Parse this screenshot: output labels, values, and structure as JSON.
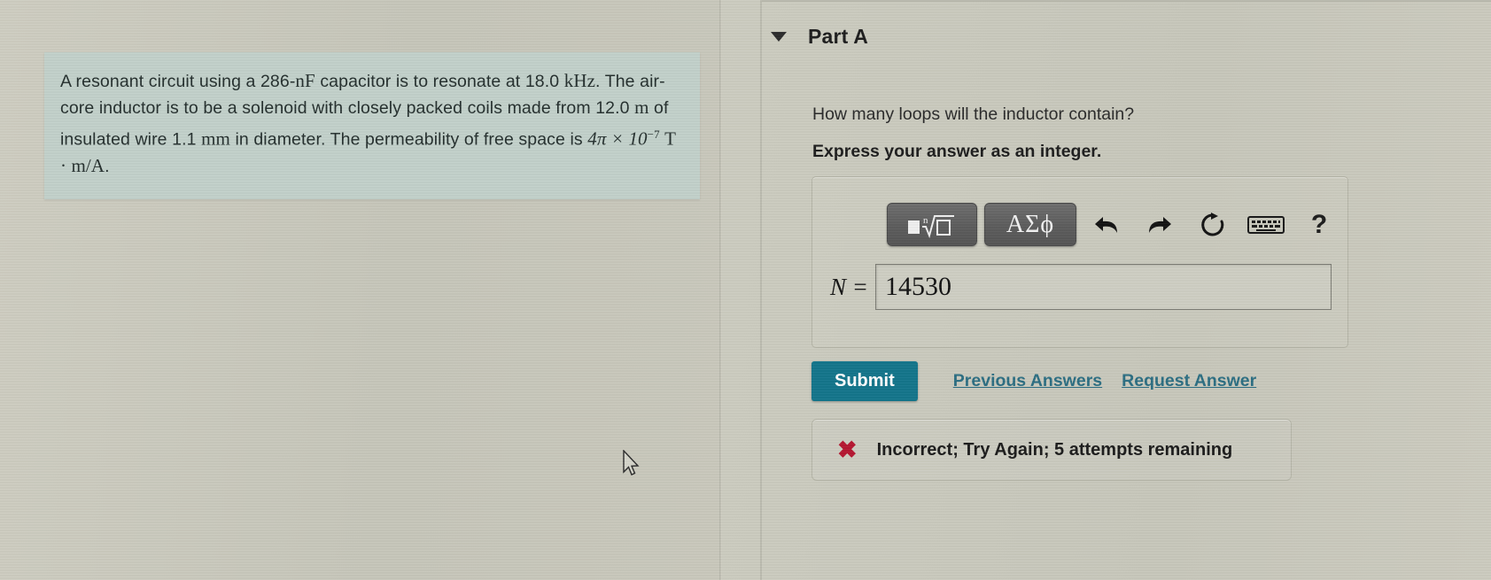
{
  "problem": {
    "sentence1_a": "A resonant circuit using a 286-",
    "sentence1_unit1": "nF",
    "sentence1_b": " capacitor is to resonate at 18.0 ",
    "sentence1_unit2": "kHz",
    "sentence1_c": ". The air-core inductor is to be a solenoid with closely packed coils made from 12.0 ",
    "sentence1_unit3": "m",
    "sentence1_d": " of insulated wire 1.1 ",
    "sentence1_unit4": "mm",
    "sentence1_e": " in diameter. The permeability of free space is ",
    "constant_coefficient": "4π × 10",
    "constant_exponent": "−7",
    "constant_units": "T · m/A",
    "sentence1_f": ".",
    "background_color": "#c3d2cb"
  },
  "part": {
    "toggle_icon": "triangle-down-icon",
    "title": "Part A"
  },
  "question": {
    "prompt": "How many loops will the inductor contain?",
    "format_instruction": "Express your answer as an integer."
  },
  "toolbar": {
    "template_button_label": "■ⁿ√□",
    "template_button_name": "math-template-icon",
    "greek_button_label": "ΑΣϕ",
    "undo_icon": "undo-arrow-icon",
    "undo_glyph": "↶",
    "redo_icon": "redo-arrow-icon",
    "redo_glyph": "↷",
    "reset_icon": "reset-circular-arrow-icon",
    "reset_glyph": "↻",
    "keyboard_icon": "keyboard-icon",
    "help_label": "?"
  },
  "answer": {
    "variable_label": "N =",
    "value": "14530",
    "placeholder": ""
  },
  "actions": {
    "submit_label": "Submit",
    "previous_answers_label": "Previous Answers",
    "request_answer_label": "Request Answer",
    "submit_color": "#14768c",
    "link_color": "#2d6f83"
  },
  "feedback": {
    "status_icon": "red-x-icon",
    "status_glyph": "✖",
    "message": "Incorrect; Try Again; 5 attempts remaining",
    "icon_color": "#b61832"
  },
  "cursor": {
    "icon": "mouse-pointer-icon"
  }
}
